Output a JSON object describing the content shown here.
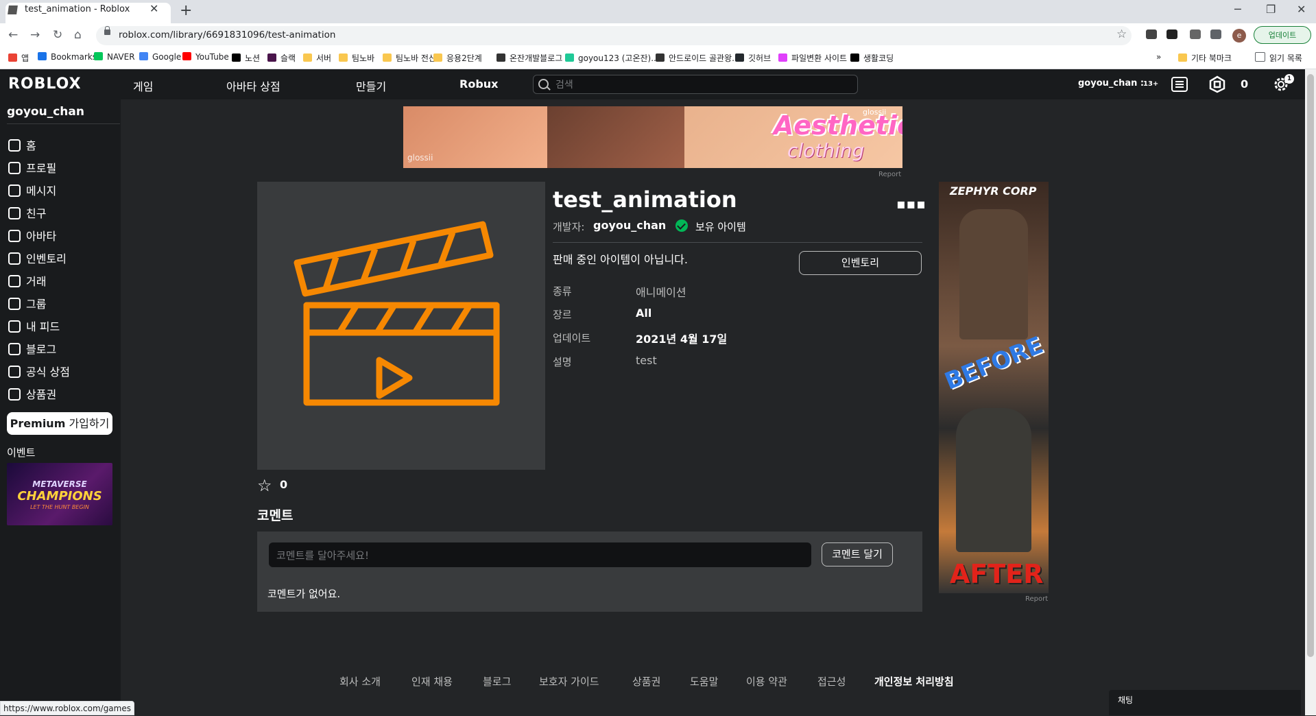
{
  "browser": {
    "tab_title": "test_animation - Roblox",
    "url": "roblox.com/library/6691831096/test-animation",
    "profile_initial": "e",
    "update_label": "업데이트",
    "status_url": "https://www.roblox.com/games"
  },
  "bookmarks": [
    {
      "label": "앱",
      "color": "#ea4335"
    },
    {
      "label": "Bookmarks",
      "color": "#1a73e8"
    },
    {
      "label": "NAVER",
      "color": "#03c75a"
    },
    {
      "label": "Google",
      "color": "#4285f4"
    },
    {
      "label": "YouTube",
      "color": "#ff0000"
    },
    {
      "label": "노션",
      "color": "#000000"
    },
    {
      "label": "슬랙",
      "color": "#4a154b"
    },
    {
      "label": "서버",
      "color": "#f9c74f"
    },
    {
      "label": "팀노바",
      "color": "#f9c74f"
    },
    {
      "label": "팀노바 전산",
      "color": "#f9c74f"
    },
    {
      "label": "응용2단계",
      "color": "#f9c74f"
    },
    {
      "label": "온잔개발블로그",
      "color": "#333333"
    },
    {
      "label": "goyou123 (고온잔)...",
      "color": "#20c997"
    },
    {
      "label": "안드로이드 골관왕...",
      "color": "#333333"
    },
    {
      "label": "깃허브",
      "color": "#24292e"
    },
    {
      "label": "파일변환 사이트",
      "color": "#e040fb"
    },
    {
      "label": "생활코딩",
      "color": "#000000"
    }
  ],
  "bookmarks_more": "»",
  "bookmarks_other": "기타 북마크",
  "bookmarks_reading": "읽기 목록",
  "header": {
    "logo": "ROBLOX",
    "nav": [
      "게임",
      "아바타 상점",
      "만들기",
      "Robux"
    ],
    "search_placeholder": "검색",
    "username": "goyou_chan :",
    "age": "13+",
    "robux": "0",
    "notif_count": "1"
  },
  "sidebar": {
    "username": "goyou_chan",
    "items": [
      {
        "label": "홈",
        "icon": "home-icon"
      },
      {
        "label": "프로필",
        "icon": "profile-icon"
      },
      {
        "label": "메시지",
        "icon": "message-icon"
      },
      {
        "label": "친구",
        "icon": "friends-icon"
      },
      {
        "label": "아바타",
        "icon": "avatar-icon"
      },
      {
        "label": "인벤토리",
        "icon": "inventory-icon"
      },
      {
        "label": "거래",
        "icon": "trade-icon"
      },
      {
        "label": "그룹",
        "icon": "groups-icon"
      },
      {
        "label": "내 피드",
        "icon": "feed-icon"
      },
      {
        "label": "블로그",
        "icon": "blog-icon"
      },
      {
        "label": "공식 상점",
        "icon": "cart-icon"
      },
      {
        "label": "상품권",
        "icon": "giftcard-icon"
      }
    ],
    "premium_label": "Premium",
    "premium_suffix": " 가입하기",
    "events_label": "이벤트",
    "event_line1": "METAVERSE",
    "event_line2": "CHAMPIONS",
    "event_line3": "LET THE HUNT BEGIN"
  },
  "top_ad": {
    "brand": "glossii",
    "title1": "Aesthetic",
    "title2": "clothing",
    "report": "Report"
  },
  "item": {
    "title": "test_animation",
    "creator_prefix": "개발자:",
    "creator": "goyou_chan",
    "owned": "보유 아이템",
    "not_for_sale": "판매 중인 아이템이 아닙니다.",
    "inventory_button": "인벤토리",
    "details": [
      {
        "label": "종류",
        "value": "애니메이션"
      },
      {
        "label": "장르",
        "value": "All"
      },
      {
        "label": "업데이트",
        "value": "2021년 4월 17일"
      },
      {
        "label": "설명",
        "value": "test"
      }
    ],
    "favorites": "0",
    "accent_color": "#f68802"
  },
  "comments": {
    "title": "코멘트",
    "placeholder": "코멘트를 달아주세요!",
    "submit": "코멘트 달기",
    "empty": "코멘트가 없어요."
  },
  "side_ad": {
    "brand": "ZEPHYR CORP",
    "before": "BEFORE",
    "after": "AFTER",
    "report": "Report"
  },
  "footer": [
    "회사 소개",
    "인재 채용",
    "블로그",
    "보호자 가이드",
    "상품권",
    "도움말",
    "이용 약관",
    "접근성",
    "개인정보 처리방침"
  ],
  "chat": {
    "label": "채팅"
  }
}
